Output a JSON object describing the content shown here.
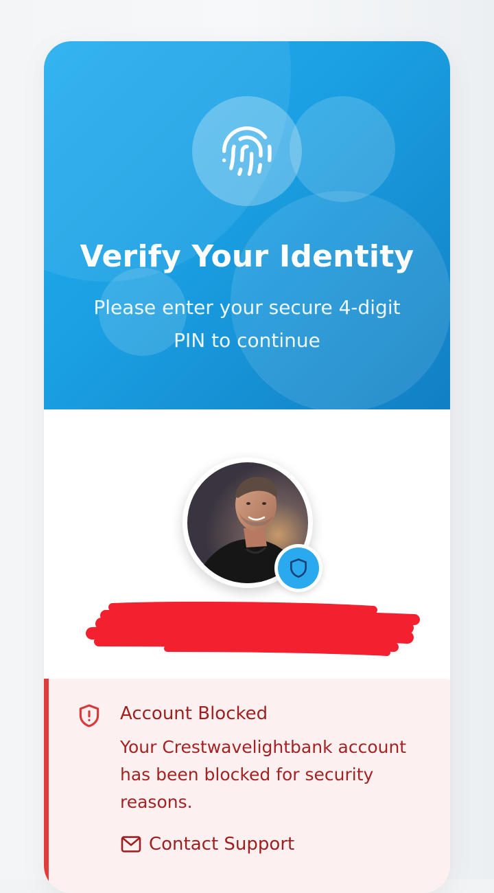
{
  "hero": {
    "title": "Verify Your Identity",
    "subtitle": "Please enter your secure 4-digit PIN to continue",
    "icon": "fingerprint-icon"
  },
  "profile": {
    "avatar": "user-avatar-photo",
    "badge_icon": "shield-icon",
    "name_redacted": true
  },
  "alert": {
    "icon": "shield-alert-icon",
    "title": "Account Blocked",
    "message": "Your Crestwavelightbank account has been blocked for security reasons.",
    "support_label": "Contact Support",
    "support_icon": "mail-icon"
  },
  "colors": {
    "hero_start": "#23aef0",
    "hero_end": "#127fc3",
    "alert_bg": "#fdf0f0",
    "alert_accent": "#e23b3b",
    "alert_text": "#9e1f1f",
    "badge": "#2ba9ee",
    "redaction": "#f3212f"
  }
}
